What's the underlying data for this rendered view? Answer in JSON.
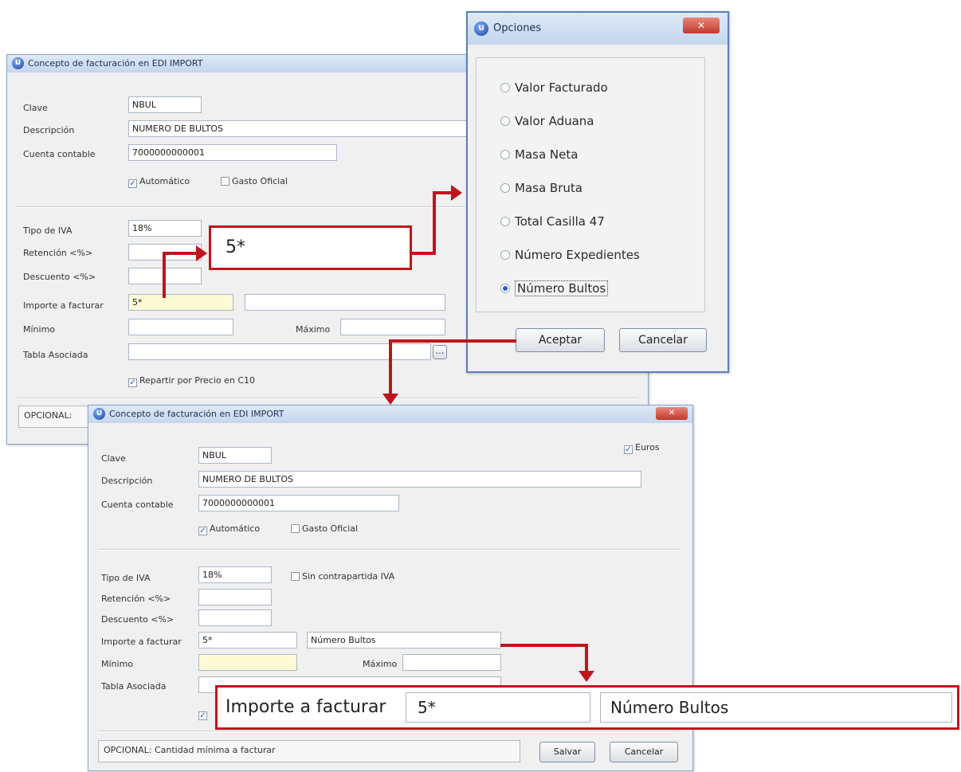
{
  "win1": {
    "title": "Concepto de facturación en EDI IMPORT",
    "labels": {
      "clave": "Clave",
      "descripcion": "Descripción",
      "cuenta": "Cuenta contable",
      "tipo_iva": "Tipo de IVA",
      "retencion": "Retención <%>",
      "descuento": "Descuento <%>",
      "importe": "Importe a facturar",
      "minimo": "Mínimo",
      "maximo": "Máximo",
      "tabla": "Tabla Asociada"
    },
    "values": {
      "clave": "NBUL",
      "descripcion": "NUMERO DE BULTOS",
      "cuenta": "7000000000001",
      "tipo_iva": "18%",
      "importe": "5*"
    },
    "automatico": "Automático",
    "gasto_oficial": "Gasto Oficial",
    "repartir": "Repartir por Precio en C10",
    "status": "OPCIONAL:"
  },
  "opciones": {
    "title": "Opciones",
    "options": [
      {
        "label": "Valor Facturado",
        "selected": false
      },
      {
        "label": "Valor Aduana",
        "selected": false
      },
      {
        "label": "Masa Neta",
        "selected": false
      },
      {
        "label": "Masa Bruta",
        "selected": false
      },
      {
        "label": "Total Casilla 47",
        "selected": false
      },
      {
        "label": "Número Expedientes",
        "selected": false
      },
      {
        "label": "Número Bultos",
        "selected": true
      }
    ],
    "accept": "Aceptar",
    "cancel": "Cancelar"
  },
  "win2": {
    "title": "Concepto de facturación en EDI IMPORT",
    "euros": "Euros",
    "labels": {
      "clave": "Clave",
      "descripcion": "Descripción",
      "cuenta": "Cuenta contable",
      "tipo_iva": "Tipo de IVA",
      "retencion": "Retención <%>",
      "descuento": "Descuento <%>",
      "importe": "Importe a facturar",
      "minimo": "Mínimo",
      "maximo": "Máximo",
      "tabla": "Tabla Asociada"
    },
    "values": {
      "clave": "NBUL",
      "descripcion": "NUMERO DE BULTOS",
      "cuenta": "7000000000001",
      "tipo_iva": "18%",
      "importe": "5*",
      "importe_desc": "Número Bultos"
    },
    "automatico": "Automático",
    "gasto_oficial": "Gasto Oficial",
    "sin_contrapartida": "Sin contrapartida IVA",
    "status": "OPCIONAL: Cantidad mínima a facturar",
    "save": "Salvar",
    "cancel": "Cancelar"
  },
  "callouts": {
    "top_value": "5*",
    "bottom_label": "Importe a facturar",
    "bottom_value": "5*",
    "bottom_desc": "Número Bultos"
  },
  "colors": {
    "accent_red": "#c0141d",
    "title_blue": "#c4d6ee"
  }
}
